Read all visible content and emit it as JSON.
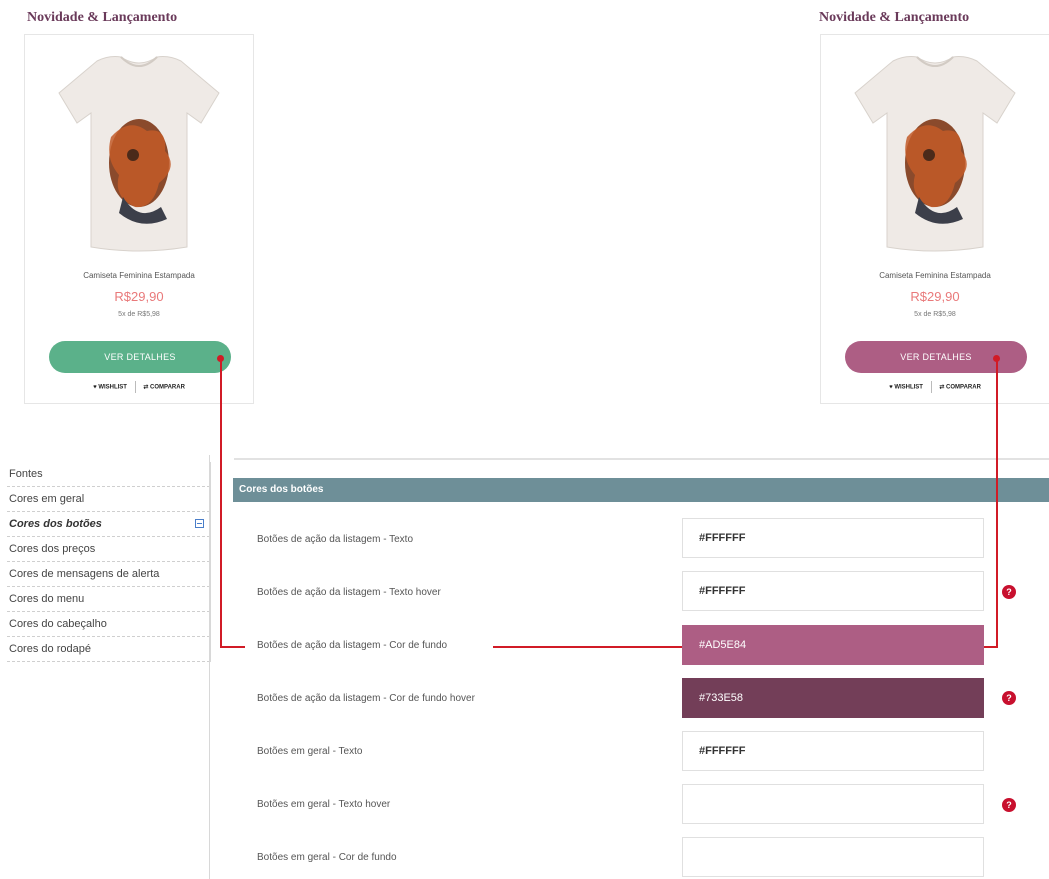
{
  "products": [
    {
      "section_title": "Novidade & Lançamento",
      "name": "Camiseta Feminina Estampada",
      "price": "R$29,90",
      "installments": "5x de R$5,98",
      "button_label": "VER DETALHES",
      "wishlist_label": "WISHLIST",
      "compare_label": "COMPARAR",
      "button_color": "#5BB18A"
    },
    {
      "section_title": "Novidade & Lançamento",
      "name": "Camiseta Feminina Estampada",
      "price": "R$29,90",
      "installments": "5x de R$5,98",
      "button_label": "VER DETALHES",
      "wishlist_label": "WISHLIST",
      "compare_label": "COMPARAR",
      "button_color": "#AD5E84"
    }
  ],
  "sidebar": {
    "items": [
      {
        "label": "Fontes"
      },
      {
        "label": "Cores em geral"
      },
      {
        "label": "Cores dos botões",
        "active": true
      },
      {
        "label": "Cores dos preços"
      },
      {
        "label": "Cores de mensagens de alerta"
      },
      {
        "label": "Cores do menu"
      },
      {
        "label": "Cores do cabeçalho"
      },
      {
        "label": "Cores do rodapé"
      }
    ]
  },
  "panel": {
    "title": "Cores dos botões",
    "rows": [
      {
        "label": "Botões de ação da listagem - Texto",
        "value": "#FFFFFF",
        "bg": "",
        "help": false
      },
      {
        "label": "Botões de ação da listagem - Texto hover",
        "value": "#FFFFFF",
        "bg": "",
        "help": true
      },
      {
        "label": "Botões de ação da listagem - Cor de fundo",
        "value": "#AD5E84",
        "bg": "#AD5E84",
        "help": false
      },
      {
        "label": "Botões de ação da listagem - Cor de fundo hover",
        "value": "#733E58",
        "bg": "#733E58",
        "help": true
      },
      {
        "label": "Botões em geral - Texto",
        "value": "#FFFFFF",
        "bg": "",
        "help": false
      },
      {
        "label": "Botões em geral - Texto hover",
        "value": "",
        "bg": "",
        "help": true
      },
      {
        "label": "Botões em geral - Cor de fundo",
        "value": "",
        "bg": "",
        "help": false
      }
    ]
  },
  "icons": {
    "help": "question-mark-icon",
    "collapse": "minus-square-icon",
    "wishlist": "heart-icon",
    "compare": "swap-arrows-icon"
  },
  "colors": {
    "annotation_line": "#D11B26",
    "panel_header": "#6E8F98"
  }
}
